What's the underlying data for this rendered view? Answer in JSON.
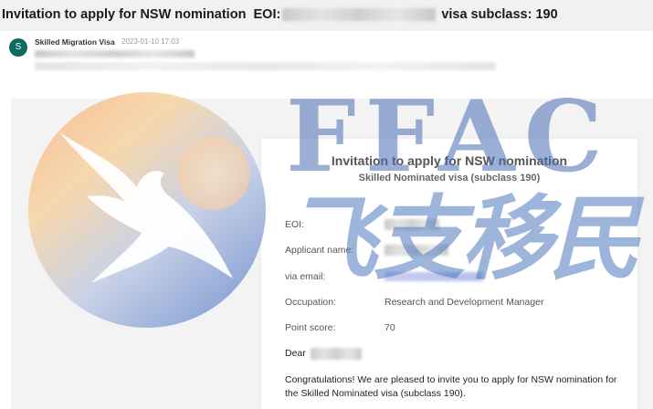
{
  "subject": {
    "prefix": "Invitation to apply for NSW nomination",
    "eoi_label": "EOI:",
    "suffix": "visa subclass: 190"
  },
  "sender": {
    "avatar_letter": "S",
    "name": "Skilled Migration Visa",
    "date": "2023-01-10 17:03"
  },
  "card": {
    "title": "Invitation to apply for NSW nomination",
    "subtitle": "Skilled Nominated visa (subclass 190)",
    "fields": {
      "eoi_label": "EOI:",
      "applicant_label": "Applicant name:",
      "email_label": "via email:",
      "occupation_label": "Occupation:",
      "occupation_value": "Research and Development Manager",
      "score_label": "Point score:",
      "score_value": "70"
    },
    "dear": "Dear",
    "congrats": "Congratulations! We are pleased to invite you to apply for NSW nomination for the Skilled Nominated visa (subclass 190)."
  },
  "watermark": {
    "latin": "FFAC",
    "chinese": "飞支移民"
  }
}
